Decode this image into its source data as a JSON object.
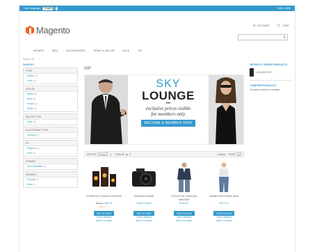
{
  "topbar": {
    "lang_label": "Your Language:",
    "lang_value": "English",
    "welcome": "WELCOME"
  },
  "header": {
    "logo": "Magento",
    "account": "ACCOUNT",
    "cart": "CART"
  },
  "nav": [
    "WOMEN",
    "MEN",
    "ACCESSORIES",
    "HOME & DECOR",
    "SALE",
    "VIP"
  ],
  "breadcrumb": "HOME / VIP",
  "sidebar": {
    "title": "SHOP BY",
    "groups": [
      {
        "name": "TYPE",
        "items": [
          {
            "label": "Denim",
            "count": "(1)"
          },
          {
            "label": "Knits",
            "count": "(1)"
          }
        ]
      },
      {
        "name": "COLOR",
        "items": [
          {
            "label": "Black",
            "count": "(3)"
          },
          {
            "label": "Blue",
            "count": "(4)"
          },
          {
            "label": "Indigo",
            "count": "(1)"
          },
          {
            "label": "White",
            "count": "(1)"
          }
        ]
      },
      {
        "name": "DECOR TYPE",
        "items": [
          {
            "label": "Vase",
            "count": "(1)"
          }
        ]
      },
      {
        "name": "ELECTRONIC TYPE",
        "items": [
          {
            "label": "Camera",
            "count": "(1)"
          }
        ]
      },
      {
        "name": "FIT",
        "items": [
          {
            "label": "Regular",
            "count": "(1)"
          },
          {
            "label": "Slim",
            "count": "(1)"
          }
        ]
      },
      {
        "name": "FORMAT",
        "items": [
          {
            "label": "Downloadable",
            "count": "(1)"
          }
        ]
      },
      {
        "name": "GENDER",
        "items": [
          {
            "label": "Female",
            "count": "(1)"
          },
          {
            "label": "Male",
            "count": "(1)"
          }
        ]
      }
    ]
  },
  "page": {
    "title": "VIP"
  },
  "banner": {
    "line1": "SKY",
    "line2": "LOUNGE",
    "dots": "•••",
    "line3": "exclusive prices visible",
    "line4": "for members only",
    "button": "BECOME A MEMBER NOW"
  },
  "toolbar": {
    "sort_label": "SORT BY",
    "sort_value": "Position",
    "view_as": "VIEW AS",
    "count": "4 Item(s)",
    "show_label": "SHOW",
    "show_value": "12"
  },
  "products": [
    {
      "name": "GEOMETRIC CANDLE HOLDERS",
      "old_price": "$50.00",
      "price": "$45.00",
      "rating": "★★★☆☆",
      "button": "ADD TO CART",
      "wish": "Add to Wishlist",
      "compare": "Add to Compare"
    },
    {
      "name": "MADISON RX3400",
      "old_price": "",
      "price": "Click for price",
      "rating": "",
      "button": "ADD TO CART",
      "wish": "Add to Wishlist",
      "compare": "Add to Compare"
    },
    {
      "name": "LEXINGTON CARDIGAN SWEATER",
      "old_price": "",
      "price": "$240.00",
      "rating": "",
      "button": "VIEW DETAILS",
      "wish": "Add to Wishlist",
      "compare": "Add to Compare"
    },
    {
      "name": "DUMBO BOYFRIEND JEAN",
      "old_price": "",
      "price": "$210.00",
      "rating": "",
      "button": "VIEW DETAILS",
      "wish": "Add to Wishlist",
      "compare": "Add to Compare"
    }
  ],
  "right": {
    "recent_title": "RECENTLY VIEWED PRODUCTS",
    "recent_item": "LUGGAGE SET",
    "compare_title": "COMPARE PRODUCTS",
    "compare_note": "You have no items to compare."
  }
}
